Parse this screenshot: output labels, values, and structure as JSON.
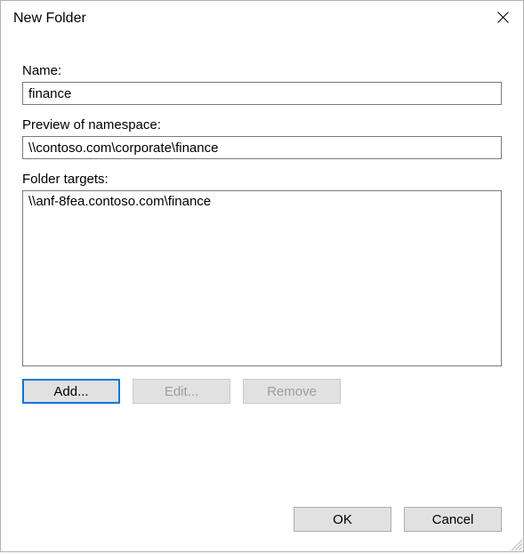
{
  "dialog": {
    "title": "New Folder"
  },
  "labels": {
    "name": "Name:",
    "preview": "Preview of namespace:",
    "targets": "Folder targets:"
  },
  "fields": {
    "name_value": "finance",
    "preview_value": "\\\\contoso.com\\corporate\\finance"
  },
  "targets": [
    "\\\\anf-8fea.contoso.com\\finance"
  ],
  "buttons": {
    "add": "Add...",
    "edit": "Edit...",
    "remove": "Remove",
    "ok": "OK",
    "cancel": "Cancel"
  }
}
